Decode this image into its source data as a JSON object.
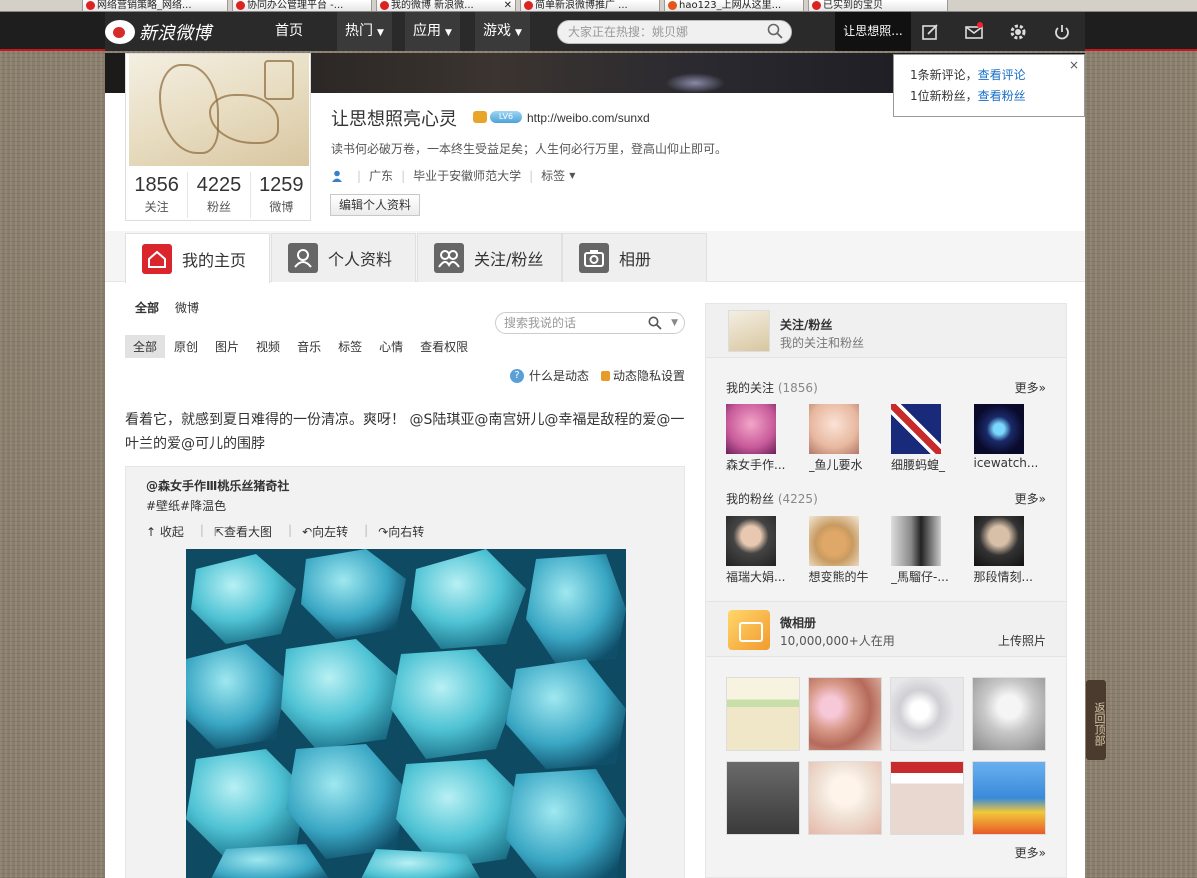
{
  "browser": {
    "tabs": [
      {
        "title": "网络营销策略_网络..."
      },
      {
        "title": "协同办公管理平台 -..."
      },
      {
        "title": "我的微博 新浪微..."
      },
      {
        "title": "简单新浪微博推广 ..."
      },
      {
        "title": "hao123_上网从这里..."
      },
      {
        "title": "已实到的宝贝"
      }
    ]
  },
  "nav": {
    "logo_text": "新浪微博",
    "home": "首页",
    "menus": [
      {
        "label": "热门"
      },
      {
        "label": "应用"
      },
      {
        "label": "游戏"
      }
    ],
    "search_placeholder": "大家正在热搜：姚贝娜",
    "user": "让思想照...",
    "icons": [
      "edit-icon",
      "message-icon",
      "gear-icon",
      "power-icon"
    ]
  },
  "profile": {
    "name": "让思想照亮心灵",
    "level_badge": "LV6",
    "url": "http://weibo.com/sunxd",
    "bio": "读书何必破万卷，一本终生受益足矣；人生何必行万里，登高山仰止即可。",
    "location": "广东",
    "school": "毕业于安徽师范大学",
    "tags_label": "标签",
    "edit_button": "编辑个人资料",
    "stats": [
      {
        "num": "1856",
        "label": "关注"
      },
      {
        "num": "4225",
        "label": "粉丝"
      },
      {
        "num": "1259",
        "label": "微博"
      }
    ]
  },
  "profile_tabs": [
    {
      "label": "我的主页",
      "color": "#d9252b"
    },
    {
      "label": "个人资料",
      "color": "#666666"
    },
    {
      "label": "关注/粉丝",
      "color": "#666666"
    },
    {
      "label": "相册",
      "color": "#666666"
    }
  ],
  "feed": {
    "tabs": [
      "全部",
      "微博"
    ],
    "search_placeholder": "搜索我说的话",
    "filters": [
      "全部",
      "原创",
      "图片",
      "视频",
      "音乐",
      "标签",
      "心情",
      "查看权限"
    ],
    "help_text": "什么是动态",
    "privacy_text": "动态隐私设置",
    "post_text": "看着它，就感到夏日难得的一份清凉。爽呀！ @S陆琪亚@南宫妍儿@幸福是敌程的爱@一叶兰的爱@可儿的围脖",
    "repost": {
      "author": "@森女手作Ⅲ桃乐丝猪奇社",
      "tags": "#壁纸#降温色",
      "actions": [
        "收起",
        "查看大图",
        "向左转",
        "向右转"
      ]
    }
  },
  "sidebar": {
    "title": "关注/粉丝",
    "subtitle": "我的关注和粉丝",
    "following_label": "我的关注",
    "following_count": "(1856)",
    "followers_label": "我的粉丝",
    "followers_count": "(4225)",
    "more": "更多»",
    "following": [
      {
        "name": "森女手作...",
        "color": "#c85a9a"
      },
      {
        "name": "_鱼儿要水",
        "color": "#e8b8a0"
      },
      {
        "name": "细腰蚂蝗_",
        "color": "#b02b2b"
      },
      {
        "name": "icewatch...",
        "color": "#1a2a6a"
      }
    ],
    "followers": [
      {
        "name": "福瑞大娟...",
        "color": "#444444"
      },
      {
        "name": "想变熊的牛",
        "color": "#c89a60"
      },
      {
        "name": "_馬騮仔-...",
        "color": "#8a8a8a"
      },
      {
        "name": "那段情刻...",
        "color": "#333333"
      }
    ],
    "album_title": "微相册",
    "album_sub": "10,000,000+人在用",
    "album_upload": "上传照片",
    "album_colors": [
      "#f4f0d8",
      "#d89a8a",
      "#e8e8ea",
      "#c8c8c8",
      "#5a5a5a",
      "#f0e4d8",
      "#e8d8d0",
      "#3a8ad8"
    ],
    "album_more": "更多»"
  },
  "notify": {
    "line1_prefix": "1条新评论，",
    "line1_link": "查看评论",
    "line2_prefix": "1位新粉丝，",
    "line2_link": "查看粉丝",
    "close": "×"
  },
  "backtop": "返回顶部"
}
